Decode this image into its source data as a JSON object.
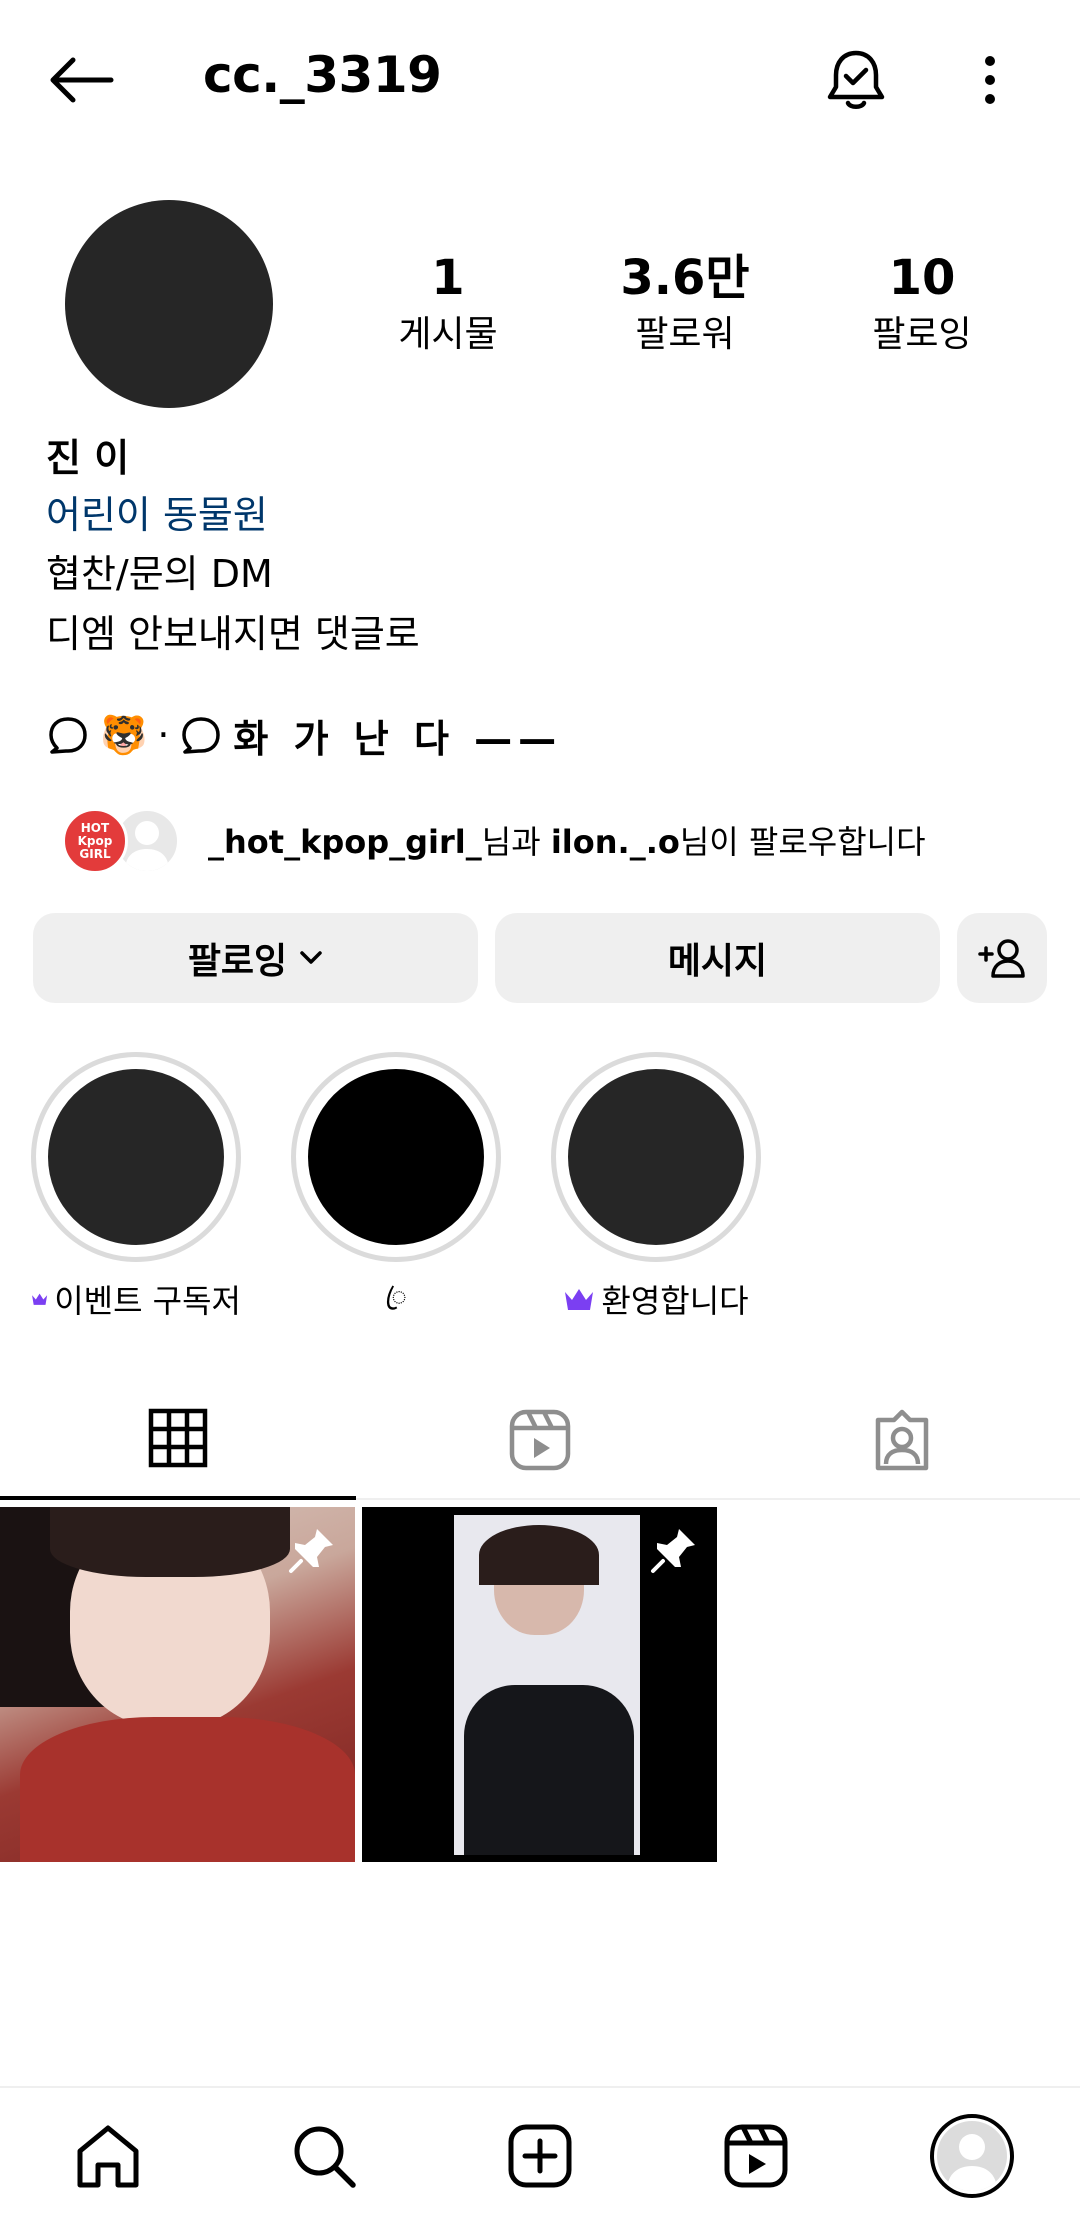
{
  "header": {
    "username": "cc._3319"
  },
  "stats": [
    {
      "value": "1",
      "label": "게시물"
    },
    {
      "value": "3.6만",
      "label": "팔로워"
    },
    {
      "value": "10",
      "label": "팔로잉"
    }
  ],
  "bio": {
    "name": "진 이",
    "category": "어린이 동물원",
    "lines": [
      "협찬/문의 DM",
      "디엠 안보내지면 댓글로"
    ],
    "threads_emoji": "🐯",
    "threads_separator": "·",
    "threads_text": "화 가 난 다 ——"
  },
  "followed_by": {
    "avatar1_text": "HOT\nKpop\nGIRL",
    "user1": "_hot_kpop_girl_",
    "mid": "님과 ",
    "user2": "ilon._.o",
    "suffix": "님이 팔로우합니다"
  },
  "buttons": {
    "following": "팔로잉",
    "message": "메시지"
  },
  "highlights": [
    {
      "label": "이벤트 구독저",
      "crown": true
    },
    {
      "label": "ꦿ",
      "crown": false
    },
    {
      "label": "환영합니다",
      "crown": true
    }
  ],
  "colors": {
    "category_link": "#00376b",
    "crown": "#7b3ff2",
    "button_bg": "#efefef"
  },
  "icons": {
    "back": "arrow-left-icon",
    "bell": "bell-check-icon",
    "more": "more-vertical-icon",
    "threads": "threads-icon",
    "add_user": "add-user-icon",
    "grid": "grid-icon",
    "reels": "reels-icon",
    "tagged": "tagged-icon",
    "pin": "pin-icon",
    "home": "home-icon",
    "search": "search-icon",
    "create": "create-icon",
    "reels_nav": "reels-nav-icon",
    "profile": "profile-avatar-icon"
  }
}
